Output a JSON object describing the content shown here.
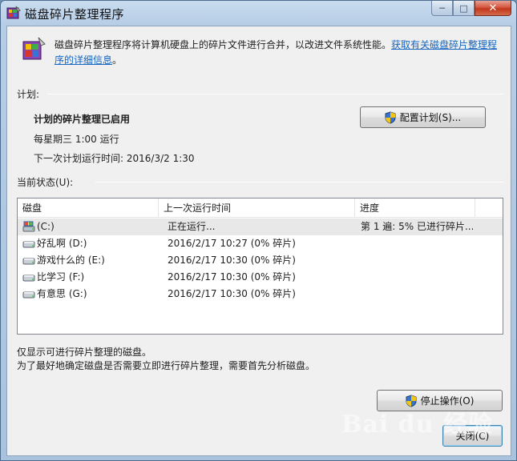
{
  "window": {
    "title": "磁盘碎片整理程序",
    "caption": {
      "minimize": "─",
      "maximize": "□",
      "close": "✕"
    }
  },
  "header": {
    "description": "磁盘碎片整理程序将计算机硬盘上的碎片文件进行合并，以改进文件系统性能。",
    "link_text": "获取有关磁盘碎片整理程序的详细信息",
    "trailing": "。",
    "icon": "defrag-app-icon"
  },
  "schedule": {
    "group_label": "计划:",
    "status": "计划的碎片整理已启用",
    "frequency": "每星期三  1:00 运行",
    "next_run": "下一次计划运行时间: 2016/3/2 1:30",
    "configure_button": "配置计划(S)..."
  },
  "current_status": {
    "group_label": "当前状态(U):",
    "columns": [
      "磁盘",
      "上一次运行时间",
      "进度"
    ],
    "rows": [
      {
        "disk": "(C:)",
        "last_run": "正在运行...",
        "progress": "第 1 遍: 5% 已进行碎片...",
        "icon": "system-drive-icon",
        "selected": true
      },
      {
        "disk": "好乱啊 (D:)",
        "last_run": "2016/2/17 10:27 (0% 碎片)",
        "progress": "",
        "icon": "hard-drive-icon",
        "selected": false
      },
      {
        "disk": "游戏什么的 (E:)",
        "last_run": "2016/2/17 10:30 (0% 碎片)",
        "progress": "",
        "icon": "hard-drive-icon",
        "selected": false
      },
      {
        "disk": "比学习 (F:)",
        "last_run": "2016/2/17 10:30 (0% 碎片)",
        "progress": "",
        "icon": "hard-drive-icon",
        "selected": false
      },
      {
        "disk": "有意思 (G:)",
        "last_run": "2016/2/17 10:30 (0% 碎片)",
        "progress": "",
        "icon": "hard-drive-icon",
        "selected": false
      }
    ]
  },
  "footer": {
    "note1": "仅显示可进行碎片整理的磁盘。",
    "note2": "为了最好地确定磁盘是否需要立即进行碎片整理，需要首先分析磁盘。",
    "stop_button": "停止操作(O)",
    "close_button": "关闭(C)"
  },
  "watermark": "Bai du 经验",
  "colors": {
    "link": "#1565c0",
    "selection": "#e8e8e8",
    "title_bar": "#b6cde6"
  }
}
